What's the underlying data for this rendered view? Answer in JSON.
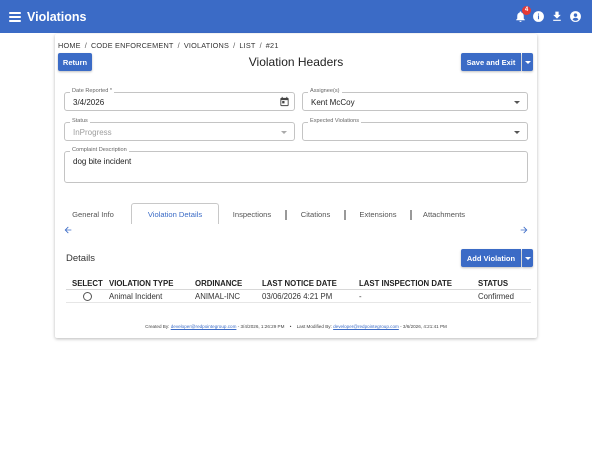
{
  "app": {
    "title": "Violations",
    "notification_count": "4"
  },
  "breadcrumb": [
    "HOME",
    "CODE ENFORCEMENT",
    "VIOLATIONS",
    "LIST",
    "#21"
  ],
  "breadcrumb_sep": "/",
  "page": {
    "title": "Violation Headers",
    "return_label": "Return",
    "save_exit_label": "Save and Exit"
  },
  "fields": {
    "date_reported": {
      "label": "Date Reported *",
      "value": "3/4/2026"
    },
    "assignee": {
      "label": "Assignee(s)",
      "value": "Kent McCoy"
    },
    "status": {
      "label": "Status",
      "value": "InProgress"
    },
    "expected_violations": {
      "label": "Expected Violations",
      "value": ""
    },
    "complaint_description": {
      "label": "Complaint Description",
      "value": "dog bite incident"
    }
  },
  "tabs": [
    {
      "label": "General Info"
    },
    {
      "label": "Violation Details",
      "active": true
    },
    {
      "label": "Inspections"
    },
    {
      "label": "Citations"
    },
    {
      "label": "Extensions"
    },
    {
      "label": "Attachments"
    }
  ],
  "details": {
    "heading": "Details",
    "add_label": "Add Violation",
    "columns": [
      "SELECT",
      "VIOLATION TYPE",
      "ORDINANCE",
      "LAST NOTICE DATE",
      "LAST INSPECTION DATE",
      "STATUS"
    ],
    "rows": [
      {
        "violation_type": "Animal Incident",
        "ordinance": "ANIMAL-INC",
        "last_notice_date": "03/06/2026 4:21 PM",
        "last_inspection_date": "-",
        "status": "Confirmed"
      }
    ]
  },
  "footer": {
    "created_label": "Created By:",
    "created_by": "developer@redpointegroup.com",
    "created_at": "- 3/4/2026, 1:26:29 PM",
    "separator": "•",
    "modified_label": "Last Modified By:",
    "modified_by": "developer@redpointegroup.com",
    "modified_at": "- 3/6/2026, 4:21:41 PM"
  },
  "colors": {
    "primary": "#3b6bc6",
    "badge": "#e53935"
  },
  "icons": {
    "menu": "menu-icon",
    "notifications": "bell-icon",
    "info": "info-icon",
    "download": "download-icon",
    "account": "account-icon",
    "calendar": "calendar-icon",
    "arrow_left": "arrow-left-icon",
    "arrow_right": "arrow-right-icon"
  }
}
